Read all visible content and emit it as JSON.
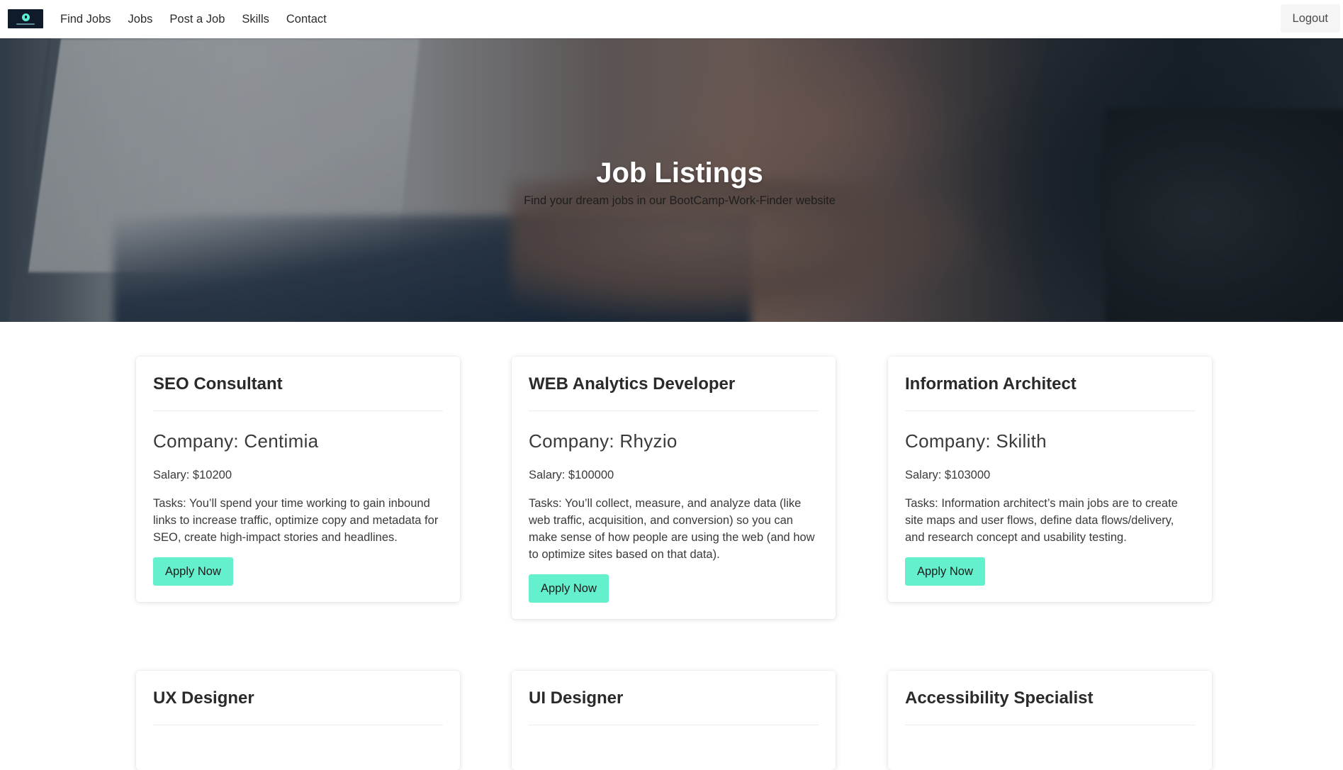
{
  "nav": {
    "links": [
      "Find Jobs",
      "Jobs",
      "Post a Job",
      "Skills",
      "Contact"
    ],
    "logout_label": "Logout"
  },
  "hero": {
    "title": "Job Listings",
    "subtitle": "Find your dream jobs in our BootCamp-Work-Finder website"
  },
  "jobs": [
    {
      "title": "SEO Consultant",
      "company": "Company: Centimia",
      "salary": "Salary: $10200",
      "tasks": "Tasks: You’ll spend your time working to gain inbound links to increase traffic, optimize copy and metadata for SEO, create high-impact stories and headlines.",
      "apply_label": "Apply Now"
    },
    {
      "title": "WEB Analytics Developer",
      "company": "Company: Rhyzio",
      "salary": "Salary: $100000",
      "tasks": "Tasks: You’ll collect, measure, and analyze data (like web traffic, acquisition, and conversion) so you can make sense of how people are using the web (and how to optimize sites based on that data).",
      "apply_label": "Apply Now"
    },
    {
      "title": "Information Architect",
      "company": "Company: Skilith",
      "salary": "Salary: $103000",
      "tasks": "Tasks: Information architect’s main jobs are to create site maps and user flows, define data flows/delivery, and research concept and usability testing.",
      "apply_label": "Apply Now"
    },
    {
      "title": "UX Designer"
    },
    {
      "title": "UI Designer"
    },
    {
      "title": "Accessibility Specialist"
    }
  ],
  "colors": {
    "accent": "#64f0cc",
    "nav_bg": "#ffffff",
    "logout_bg": "#f5f5f5"
  }
}
